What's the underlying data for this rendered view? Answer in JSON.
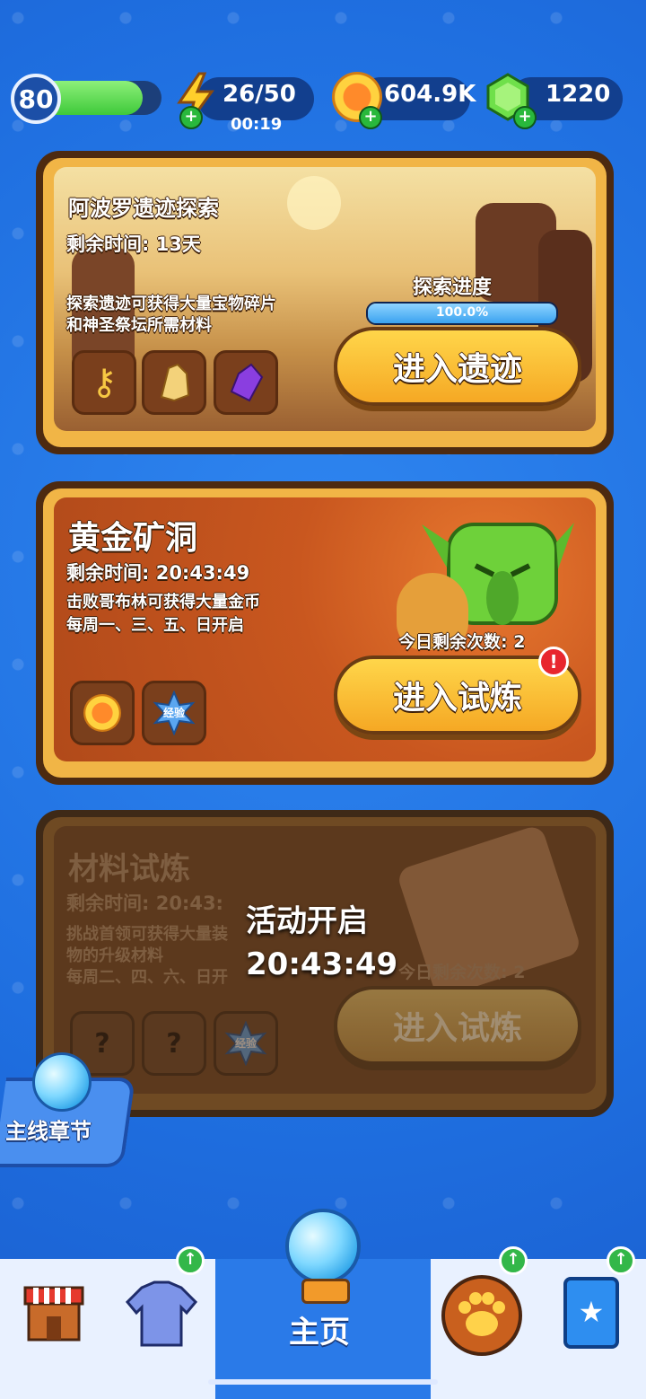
{
  "topbar": {
    "level": "80",
    "xp_progress": 0.85,
    "energy": {
      "value": "26/50",
      "timer": "00:19",
      "icon": "lightning-icon"
    },
    "coins": {
      "value": "604.9K",
      "icon": "coin-icon"
    },
    "gems": {
      "value": "1220",
      "icon": "gem-icon"
    }
  },
  "cards": [
    {
      "title": "阿波罗遗迹探索",
      "remaining": "剩余时间: 13天",
      "desc_line1": "探索遗迹可获得大量宝物碎片",
      "desc_line2": "和神圣祭坛所需材料",
      "progress_label": "探索进度",
      "progress_value": "100.0%",
      "progress": 1.0,
      "button": "进入遗迹",
      "rewards": [
        "golden-key-icon",
        "gold-crystal-icon",
        "purple-gem-icon"
      ]
    },
    {
      "title": "黄金矿洞",
      "remaining": "剩余时间: 20:43:49",
      "desc_line1": "击败哥布林可获得大量金币",
      "desc_line2": "每周一、三、五、日开启",
      "count": "今日剩余次数: 2",
      "button": "进入试炼",
      "badge": "!",
      "reward_exp_label": "经验",
      "rewards": [
        "coin-icon",
        "exp-star-icon"
      ]
    },
    {
      "title": "材料试炼",
      "remaining": "剩余时间: 20:43:",
      "desc_line1": "挑战首领可获得大量装",
      "desc_line2": "物的升级材料",
      "desc_line3": "每周二、四、六、日开",
      "count": "今日剩余次数: 2",
      "button": "进入试炼",
      "locked_title": "活动开启",
      "locked_timer": "20:43:49",
      "reward_exp_label": "经验",
      "rewards": [
        "mystery-cup-icon",
        "mystery-fruit-icon",
        "exp-star-icon"
      ]
    }
  ],
  "chapter": {
    "label": "主线章节"
  },
  "nav": {
    "home_label": "主页"
  },
  "colors": {
    "accent_blue": "#2a7ae8",
    "gold": "#f1b546",
    "button": "#f5a824"
  }
}
